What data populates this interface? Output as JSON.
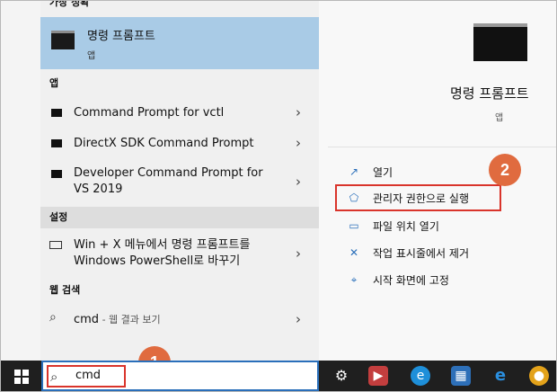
{
  "left": {
    "best_match_header": "가장 정확",
    "best_match": {
      "title": "명령 프롬프트",
      "subtitle": "앱"
    },
    "apps_header": "앱",
    "apps": [
      {
        "label": "Command Prompt for vctl"
      },
      {
        "label": "DirectX SDK Command Prompt"
      },
      {
        "label": "Developer Command Prompt for VS 2019"
      }
    ],
    "settings_header": "설정",
    "settings_item": "Win + X 메뉴에서 명령 프롬프트를 Windows PowerShell로 바꾸기",
    "web_header": "웹 검색",
    "web_item": {
      "query": "cmd",
      "suffix": " - 웹 결과 보기"
    }
  },
  "right": {
    "title": "명령 프롬프트",
    "subtitle": "앱",
    "actions": [
      {
        "label": "열기",
        "icon": "open-icon"
      },
      {
        "label": "관리자 권한으로 실행",
        "icon": "shield-icon"
      },
      {
        "label": "파일 위치 열기",
        "icon": "folder-icon"
      },
      {
        "label": "작업 표시줄에서 제거",
        "icon": "unpin-icon"
      },
      {
        "label": "시작 화면에 고정",
        "icon": "pin-icon"
      }
    ]
  },
  "taskbar": {
    "search_value": "cmd"
  },
  "badges": {
    "one": "1",
    "two": "2"
  },
  "colors": {
    "highlight": "#a9cbe6",
    "callout_border": "#d9342b",
    "badge": "#e06b3f",
    "taskbar": "#1f1f1f"
  }
}
